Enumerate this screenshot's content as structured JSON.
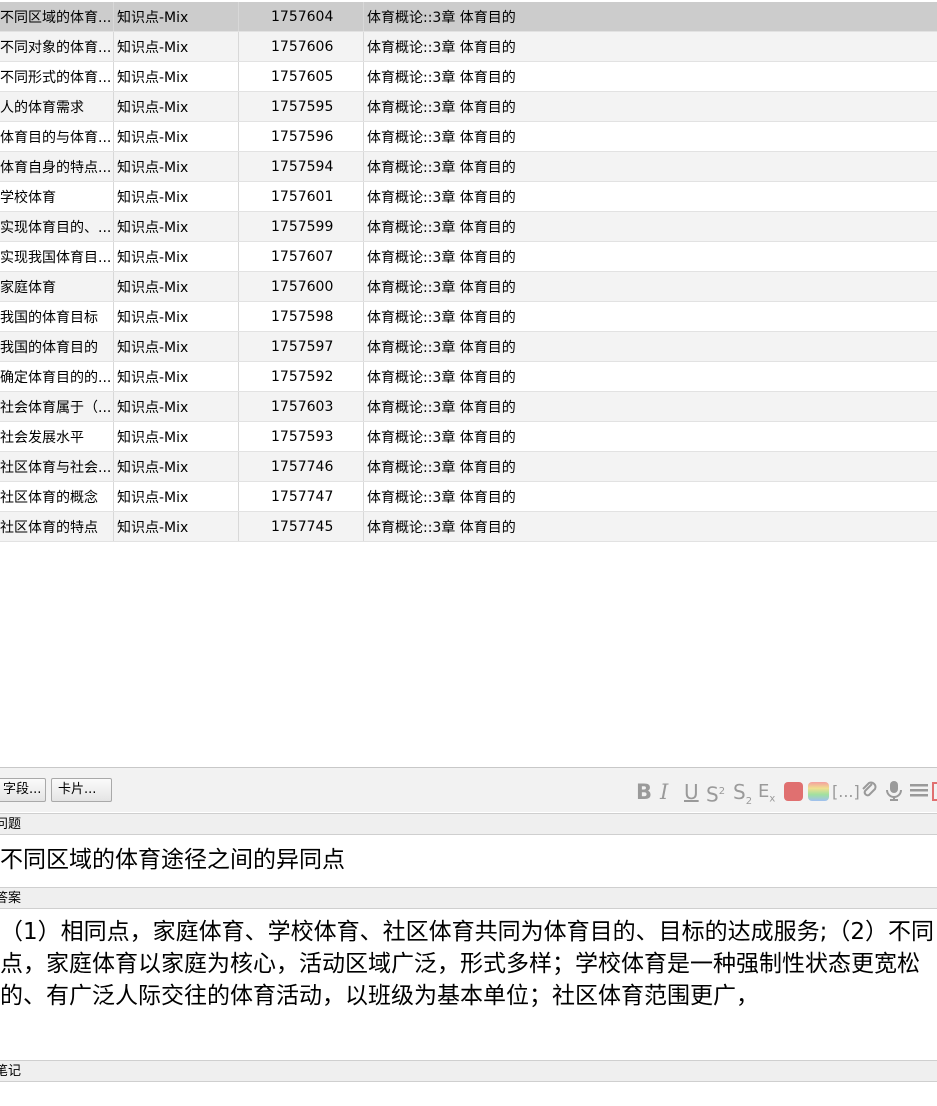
{
  "rows": [
    {
      "sort_field": "不同区域的体育...",
      "note_type": "知识点-Mix",
      "card_id": "1757604",
      "deck": "体育概论::3章 体育目的",
      "selected": true
    },
    {
      "sort_field": "不同对象的体育...",
      "note_type": "知识点-Mix",
      "card_id": "1757606",
      "deck": "体育概论::3章 体育目的"
    },
    {
      "sort_field": "不同形式的体育...",
      "note_type": "知识点-Mix",
      "card_id": "1757605",
      "deck": "体育概论::3章 体育目的"
    },
    {
      "sort_field": "人的体育需求",
      "note_type": "知识点-Mix",
      "card_id": "1757595",
      "deck": "体育概论::3章 体育目的"
    },
    {
      "sort_field": "体育目的与体育...",
      "note_type": "知识点-Mix",
      "card_id": "1757596",
      "deck": "体育概论::3章 体育目的"
    },
    {
      "sort_field": "体育自身的特点...",
      "note_type": "知识点-Mix",
      "card_id": "1757594",
      "deck": "体育概论::3章 体育目的"
    },
    {
      "sort_field": "学校体育",
      "note_type": "知识点-Mix",
      "card_id": "1757601",
      "deck": "体育概论::3章 体育目的"
    },
    {
      "sort_field": "实现体育目的、...",
      "note_type": "知识点-Mix",
      "card_id": "1757599",
      "deck": "体育概论::3章 体育目的"
    },
    {
      "sort_field": "实现我国体育目...",
      "note_type": "知识点-Mix",
      "card_id": "1757607",
      "deck": "体育概论::3章 体育目的"
    },
    {
      "sort_field": "家庭体育",
      "note_type": "知识点-Mix",
      "card_id": "1757600",
      "deck": "体育概论::3章 体育目的"
    },
    {
      "sort_field": "我国的体育目标",
      "note_type": "知识点-Mix",
      "card_id": "1757598",
      "deck": "体育概论::3章 体育目的"
    },
    {
      "sort_field": "我国的体育目的",
      "note_type": "知识点-Mix",
      "card_id": "1757597",
      "deck": "体育概论::3章 体育目的"
    },
    {
      "sort_field": "确定体育目的的...",
      "note_type": "知识点-Mix",
      "card_id": "1757592",
      "deck": "体育概论::3章 体育目的"
    },
    {
      "sort_field": "社会体育属于（...",
      "note_type": "知识点-Mix",
      "card_id": "1757603",
      "deck": "体育概论::3章 体育目的"
    },
    {
      "sort_field": "社会发展水平",
      "note_type": "知识点-Mix",
      "card_id": "1757593",
      "deck": "体育概论::3章 体育目的"
    },
    {
      "sort_field": "社区体育与社会...",
      "note_type": "知识点-Mix",
      "card_id": "1757746",
      "deck": "体育概论::3章 体育目的"
    },
    {
      "sort_field": "社区体育的概念",
      "note_type": "知识点-Mix",
      "card_id": "1757747",
      "deck": "体育概论::3章 体育目的"
    },
    {
      "sort_field": "社区体育的特点",
      "note_type": "知识点-Mix",
      "card_id": "1757745",
      "deck": "体育概论::3章 体育目的"
    }
  ],
  "editor": {
    "fields_button": "字段...",
    "cards_button": "卡片...",
    "format_icons": [
      "bold-icon",
      "italic-icon",
      "underline-icon",
      "superscript-icon",
      "subscript-icon",
      "clear-format-icon",
      "text-color-icon",
      "highlight-icon",
      "cloze-icon",
      "attach-icon",
      "record-audio-icon",
      "menu-icon"
    ],
    "fields": [
      {
        "label": "问题",
        "content": "不同区域的体育途径之间的异同点"
      },
      {
        "label": "答案",
        "content": "（1）相同点，家庭体育、学校体育、社区体育共同为体育目的、目标的达成服务;（2）不同点，家庭体育以家庭为核心，活动区域广泛，形式多样；学校体育是一种强制性状态更宽松的、有广泛人际交往的体育活动，以班级为基本单位；社区体育范围更广，"
      },
      {
        "label": "笔记",
        "content": ""
      }
    ]
  },
  "colors": {
    "selected_row": "#cccccc",
    "alt_row": "#f3f3f3",
    "icon_gray": "#9a9a9a",
    "text_color_red": "#e07070"
  }
}
